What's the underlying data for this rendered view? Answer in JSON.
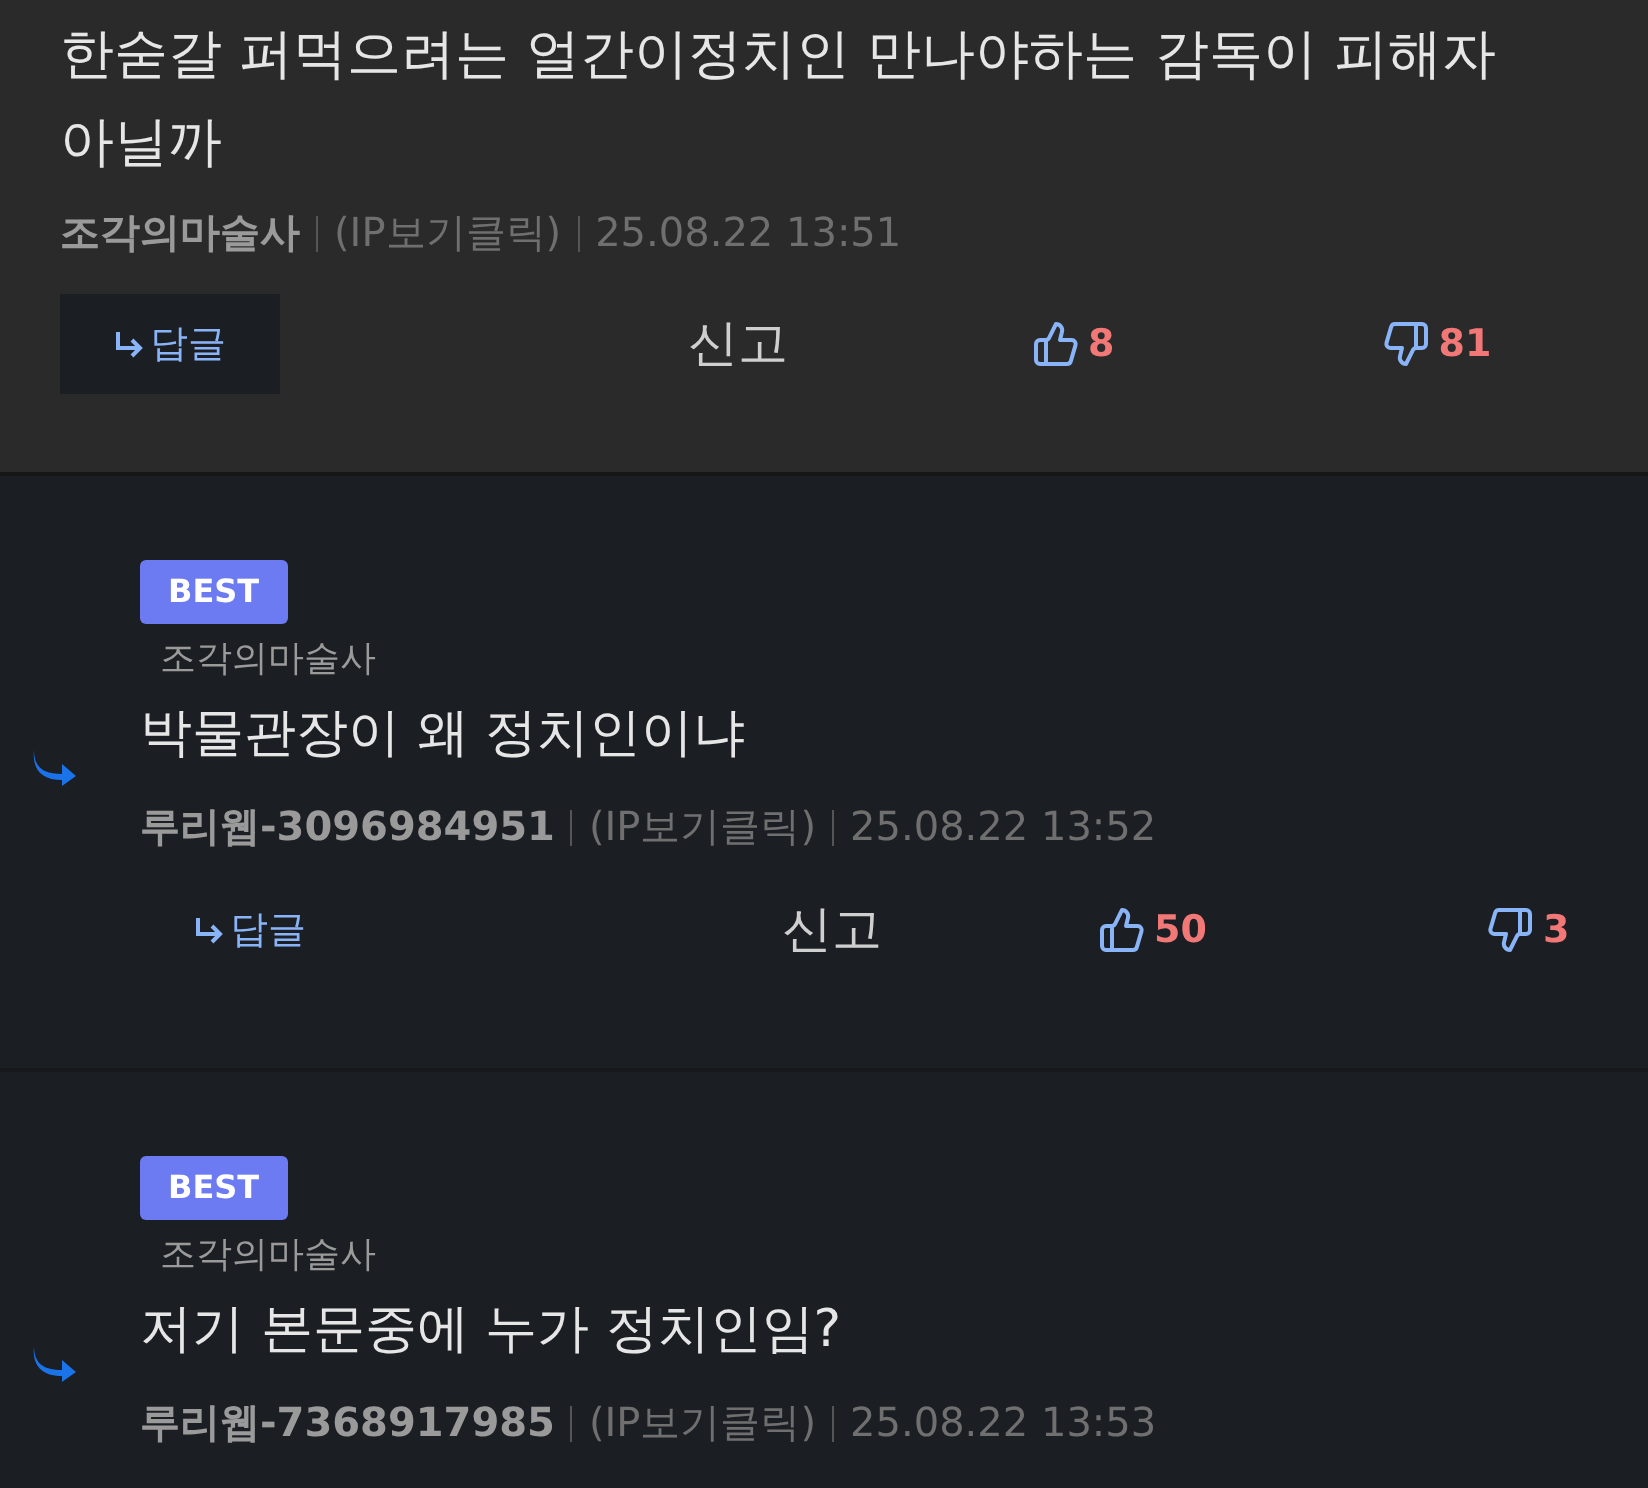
{
  "comments": [
    {
      "kind": "comment",
      "text": "한숟갈 퍼먹으려는 얼간이정치인 만나야하는 감독이 피해자 아닐까",
      "author": "조각의마술사",
      "ip": "(IP보기클릭)",
      "time": "25.08.22 13:51",
      "reply_label": "답글",
      "report_label": "신고",
      "likes": "8",
      "dislikes": "81"
    },
    {
      "kind": "reply",
      "badge": "BEST",
      "parent_author": "조각의마술사",
      "text": "박물관장이 왜 정치인이냐",
      "author": "루리웹-3096984951",
      "ip": "(IP보기클릭)",
      "time": "25.08.22 13:52",
      "reply_label": "답글",
      "report_label": "신고",
      "likes": "50",
      "dislikes": "3"
    },
    {
      "kind": "reply",
      "badge": "BEST",
      "parent_author": "조각의마술사",
      "text": "저기 본문중에 누가 정치인임?",
      "author": "루리웹-7368917985",
      "ip": "(IP보기클릭)",
      "time": "25.08.22 13:53"
    }
  ]
}
